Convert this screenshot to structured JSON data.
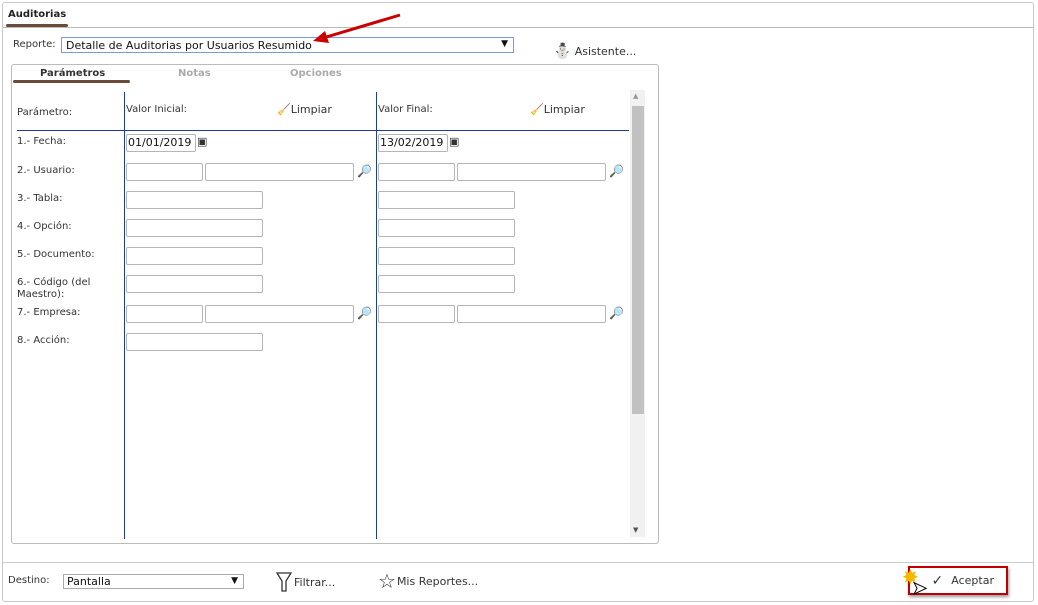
{
  "window": {
    "tab": "Auditorias"
  },
  "report": {
    "label": "Reporte:",
    "value": "Detalle de Auditorias por Usuarios Resumido",
    "wizard": "Asistente..."
  },
  "tabs": [
    "Parámetros",
    "Notas",
    "Opciones"
  ],
  "header": {
    "param": "Parámetro:",
    "initial": "Valor Inicial:",
    "final": "Valor Final:",
    "clear": "Limpiar"
  },
  "params": [
    {
      "label": "1.- Fecha:",
      "type": "date",
      "initial": "01/01/2019",
      "final": "13/02/2019"
    },
    {
      "label": "2.- Usuario:",
      "type": "lookup"
    },
    {
      "label": "3.- Tabla:",
      "type": "text"
    },
    {
      "label": "4.- Opción:",
      "type": "text"
    },
    {
      "label": "5.- Documento:",
      "type": "text"
    },
    {
      "label": "6.- Código (del Maestro):",
      "type": "text"
    },
    {
      "label": "7.- Empresa:",
      "type": "lookup"
    },
    {
      "label": "8.- Acción:",
      "type": "text-single"
    }
  ],
  "footer": {
    "dest_label": "Destino:",
    "dest_value": "Pantalla",
    "filter": "Filtrar...",
    "my_reports": "Mis Reportes...",
    "accept": "Aceptar"
  },
  "colors": {
    "accent_line": "#1c3f94",
    "tab_underline": "#6b4a3a",
    "highlight": "#c00000"
  }
}
